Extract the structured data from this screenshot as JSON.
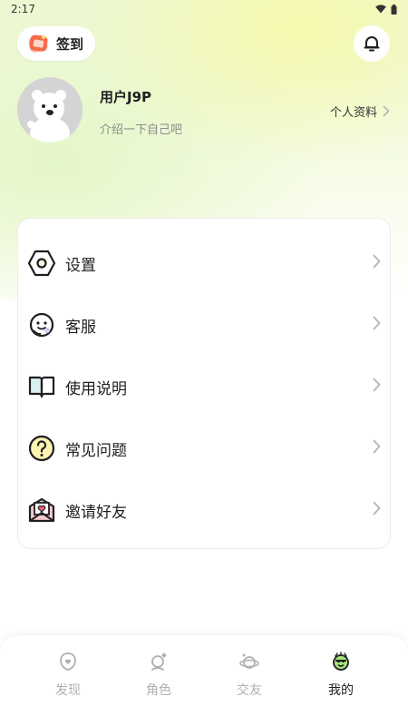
{
  "status_bar": {
    "time": "2:17"
  },
  "header": {
    "checkin_label": "签到"
  },
  "profile": {
    "username": "用户J9P",
    "bio": "介绍一下自己吧",
    "profile_link": "个人资料"
  },
  "menu": {
    "items": [
      {
        "label": "设置",
        "icon": "settings-hex-icon"
      },
      {
        "label": "客服",
        "icon": "customer-service-icon"
      },
      {
        "label": "使用说明",
        "icon": "manual-book-icon"
      },
      {
        "label": "常见问题",
        "icon": "faq-question-icon"
      },
      {
        "label": "邀请好友",
        "icon": "invite-envelope-icon"
      }
    ]
  },
  "tabbar": {
    "tabs": [
      {
        "label": "发现",
        "icon": "discover-icon",
        "active": false
      },
      {
        "label": "角色",
        "icon": "character-icon",
        "active": false
      },
      {
        "label": "交友",
        "icon": "friends-planet-icon",
        "active": false
      },
      {
        "label": "我的",
        "icon": "me-icon",
        "active": true
      }
    ]
  },
  "colors": {
    "accent_green": "#a8e27a",
    "text_primary": "#1f1f1f",
    "text_secondary": "#8a8a8a",
    "tab_inactive": "#b0b0b0",
    "checkin_orange": "#f26b4a",
    "faq_yellow": "#fff3b0",
    "invite_pink": "#f7c9cf"
  }
}
